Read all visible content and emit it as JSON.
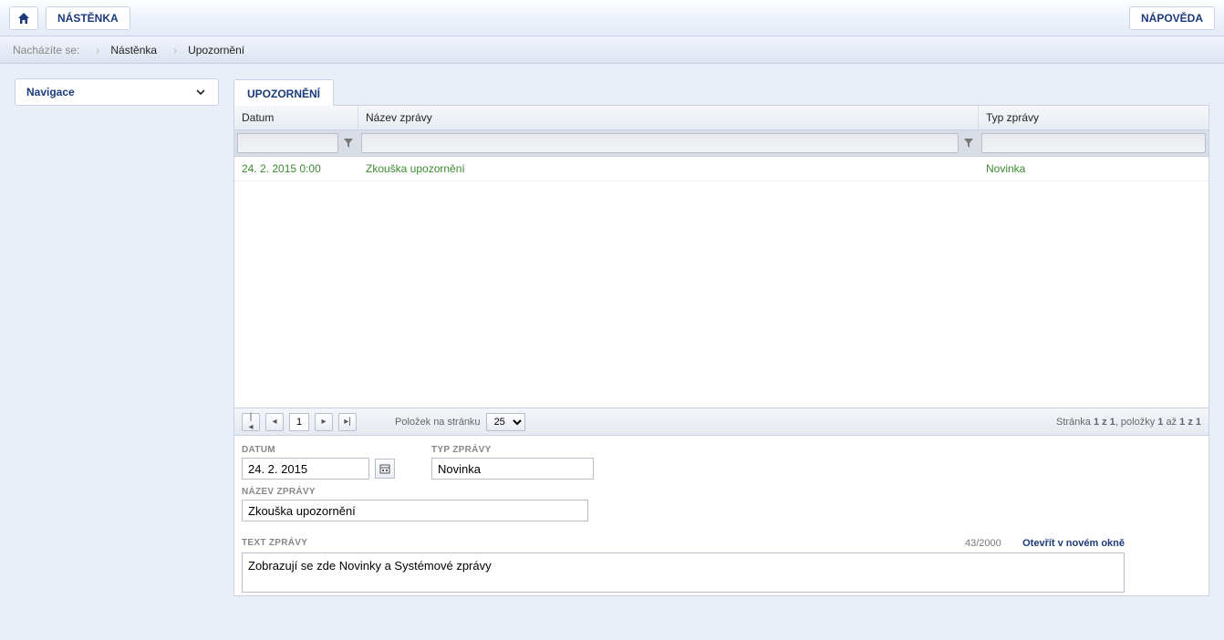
{
  "topbar": {
    "dashboard_label": "NÁSTĚNKA",
    "help_label": "NÁPOVĚDA"
  },
  "breadcrumb": {
    "here_label": "Nacházíte se:",
    "items": [
      "Nástěnka",
      "Upozornění"
    ]
  },
  "sidebar": {
    "nav_label": "Navigace"
  },
  "tab": {
    "title": "UPOZORNĚNÍ"
  },
  "grid": {
    "columns": {
      "date": "Datum",
      "name": "Název zprávy",
      "type": "Typ zprávy"
    },
    "rows": [
      {
        "date": "24. 2. 2015 0:00",
        "name": "Zkouška upozornění",
        "type": "Novinka"
      }
    ]
  },
  "pager": {
    "page_value": "1",
    "per_page_label": "Položek na stránku",
    "per_page_value": "25",
    "status_prefix": "Stránka ",
    "status_mid1": "1 z 1",
    "status_mid2": ", položky ",
    "status_mid3": "1",
    "status_mid4": " až ",
    "status_mid5": "1 z 1"
  },
  "detail": {
    "date_label": "DATUM",
    "date_value": "24. 2. 2015",
    "type_label": "TYP ZPRÁVY",
    "type_value": "Novinka",
    "name_label": "NÁZEV ZPRÁVY",
    "name_value": "Zkouška upozornění",
    "text_label": "TEXT ZPRÁVY",
    "counter": "43/2000",
    "open_new_window": "Otevřít v novém okně",
    "text_value": "Zobrazují se zde Novinky a Systémové zprávy"
  }
}
